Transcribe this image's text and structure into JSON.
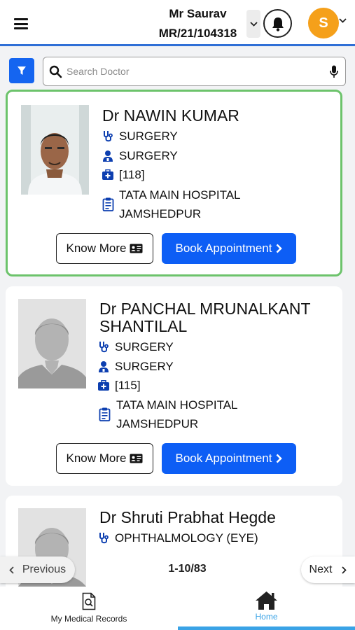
{
  "header": {
    "user_name": "Mr Saurav",
    "user_id": "MR/21/104318",
    "avatar_initial": "S"
  },
  "search": {
    "placeholder": "Search Doctor"
  },
  "doctors": [
    {
      "name": "Dr NAWIN KUMAR",
      "specialty": "SURGERY",
      "department": "SURGERY",
      "room": "[118]",
      "hospital_line1": "TATA MAIN HOSPITAL",
      "hospital_line2": "JAMSHEDPUR",
      "know_more_label": "Know More",
      "book_label": "Book Appointment"
    },
    {
      "name_line1": "Dr PANCHAL MRUNALKANT",
      "name_line2": "SHANTILAL",
      "specialty": "SURGERY",
      "department": "SURGERY",
      "room": "[115]",
      "hospital_line1": "TATA MAIN HOSPITAL",
      "hospital_line2": "JAMSHEDPUR",
      "know_more_label": "Know More",
      "book_label": "Book Appointment"
    },
    {
      "name": "Dr Shruti Prabhat Hegde",
      "specialty": "OPHTHALMOLOGY (EYE)"
    }
  ],
  "pagination": {
    "previous_label": "Previous",
    "page_info": "1-10/83",
    "next_label": "Next"
  },
  "bottom_nav": {
    "records_label": "My Medical Records",
    "home_label": "Home"
  },
  "colors": {
    "primary_blue": "#0d5ef5",
    "selected_border": "#6cc36b",
    "avatar_orange": "#f5a01a",
    "active_tab": "#3aa3e6"
  },
  "icons": {
    "menu": "hamburger-icon",
    "bell": "bell-icon",
    "filter": "filter-icon",
    "search": "search-icon",
    "mic": "mic-icon",
    "specialty": "stethoscope-icon",
    "department": "doctor-icon",
    "room": "medical-kit-icon",
    "hospital": "clipboard-icon",
    "home": "home-icon",
    "records": "document-search-icon"
  }
}
